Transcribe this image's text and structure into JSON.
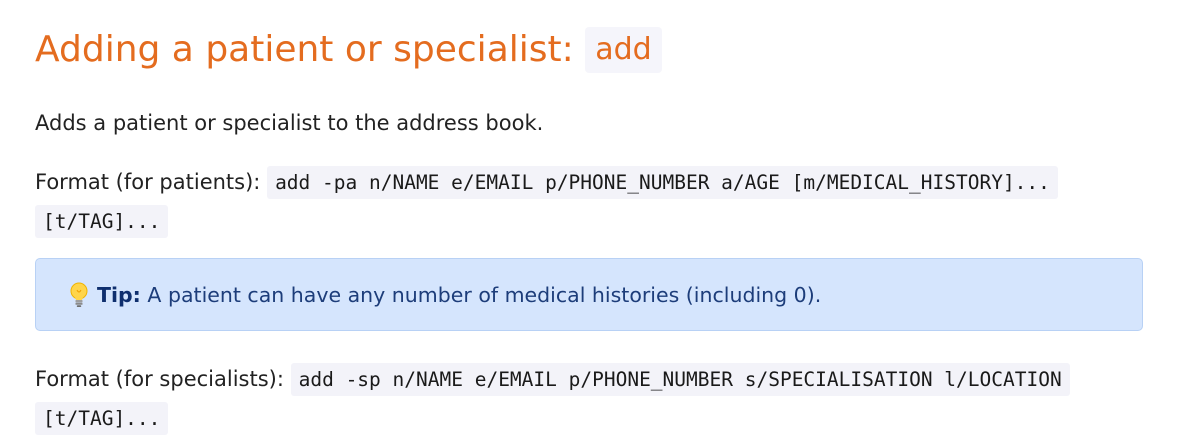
{
  "heading": {
    "text": "Adding a patient or specialist:",
    "command": "add"
  },
  "intro": "Adds a patient or specialist to the address book.",
  "format_patients": {
    "label": "Format (for patients):",
    "code_line1": "add -pa n/NAME e/EMAIL p/PHONE_NUMBER a/AGE [m/MEDICAL_HISTORY]...",
    "code_line2": "[t/TAG]..."
  },
  "tip": {
    "icon": "lightbulb-icon",
    "label": "Tip:",
    "text": "A patient can have any number of medical histories (including 0)."
  },
  "format_specialists": {
    "label": "Format (for specialists):",
    "code_line1": "add -sp n/NAME e/EMAIL p/PHONE_NUMBER s/SPECIALISATION l/LOCATION",
    "code_line2": "[t/TAG]..."
  },
  "colors": {
    "heading": "#e46c1f",
    "tip_background": "#d5e5fd",
    "tip_text": "#1d3d7a",
    "code_background": "#f3f3f9"
  }
}
